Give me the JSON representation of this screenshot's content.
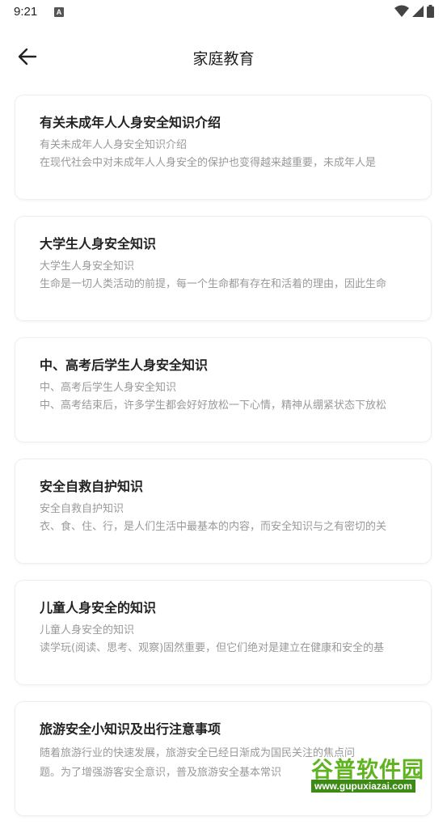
{
  "status_bar": {
    "time": "9:21",
    "notification_icon": "a-icon",
    "icons": [
      "wifi-icon",
      "signal-icon",
      "battery-icon"
    ]
  },
  "app_bar": {
    "back_icon": "arrow-left-icon",
    "title": "家庭教育"
  },
  "articles": [
    {
      "title": "有关未成年人人身安全知识介绍",
      "subtitle": "有关未成年人人身安全知识介绍",
      "desc": "在现代社会中对未成年人人身安全的保护也变得越来越重要，未成年人是"
    },
    {
      "title": "大学生人身安全知识",
      "subtitle": "大学生人身安全知识",
      "desc": "生命是一切人类活动的前提，每一个生命都有存在和活着的理由，因此生命"
    },
    {
      "title": "中、高考后学生人身安全知识",
      "subtitle": "中、高考后学生人身安全知识",
      "desc": "中、高考结束后，许多学生都会好好放松一下心情，精神从绷紧状态下放松"
    },
    {
      "title": "安全自救自护知识",
      "subtitle": "安全自救自护知识",
      "desc": "衣、食、住、行，是人们生活中最基本的内容，而安全知识与之有密切的关"
    },
    {
      "title": "儿童人身安全的知识",
      "subtitle": "儿童人身安全的知识",
      "desc": "读学玩(阅读、思考、观察)固然重要，但它们绝对是建立在健康和安全的基"
    },
    {
      "title": "旅游安全小知识及出行注意事项",
      "desc_line1": "随着旅游行业的快速发展，旅游安全已经日渐成为国民关注的焦点问",
      "desc_line2": "题。为了增强游客安全意识，普及旅游安全基本常识"
    }
  ],
  "watermark": {
    "main": "谷普软件园",
    "url": "www.gupuxiazai.com"
  }
}
